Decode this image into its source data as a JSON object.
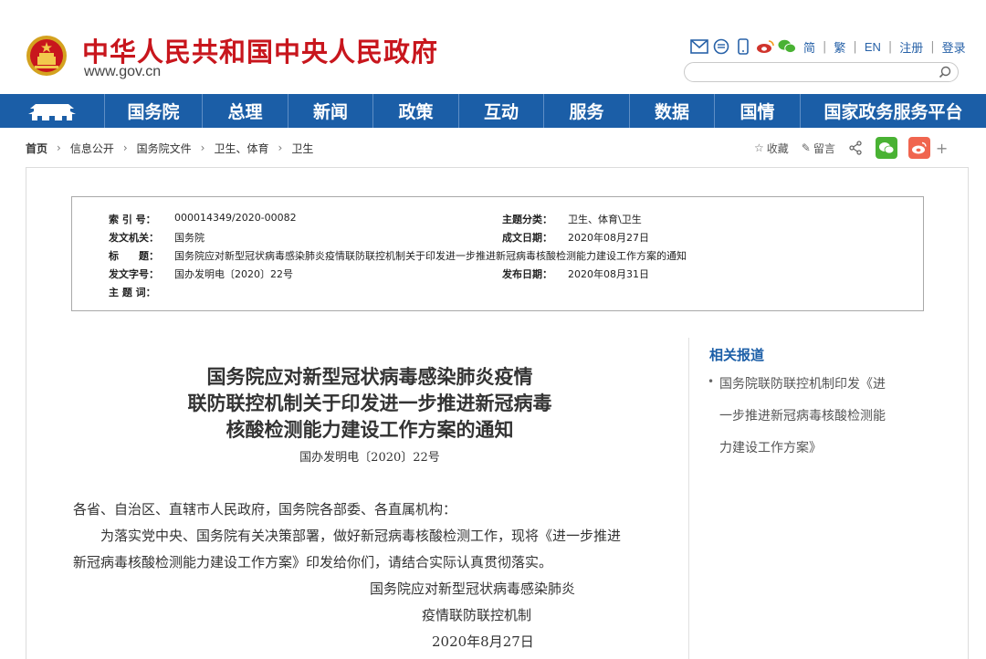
{
  "header": {
    "site_title": "中华人民共和国中央人民政府",
    "site_url": "www.gov.cn",
    "top_links": [
      "简",
      "繁",
      "EN",
      "注册",
      "登录"
    ],
    "search_placeholder": ""
  },
  "nav": {
    "items": [
      "国务院",
      "总理",
      "新闻",
      "政策",
      "互动",
      "服务",
      "数据",
      "国情",
      "国家政务服务平台"
    ]
  },
  "breadcrumb": [
    "首页",
    "信息公开",
    "国务院文件",
    "卫生、体育",
    "卫生"
  ],
  "share": {
    "collect": "收藏",
    "comment": "留言",
    "plus": "+"
  },
  "meta": {
    "index_label": "索 引 号：",
    "index_value": "000014349/2020-00082",
    "topic_label": "主题分类：",
    "topic_value": "卫生、体育\\卫生",
    "issuer_label": "发文机关：",
    "issuer_value": "国务院",
    "written_label": "成文日期：",
    "written_value": "2020年08月27日",
    "title_label": "标　　题：",
    "title_value": "国务院应对新型冠状病毒感染肺炎疫情联防联控机制关于印发进一步推进新冠病毒核酸检测能力建设工作方案的通知",
    "docno_label": "发文字号：",
    "docno_value": "国办发明电〔2020〕22号",
    "published_label": "发布日期：",
    "published_value": "2020年08月31日",
    "keywords_label": "主 题 词："
  },
  "article": {
    "title_lines": [
      "国务院应对新型冠状病毒感染肺炎疫情",
      "联防联控机制关于印发进一步推进新冠病毒",
      "核酸检测能力建设工作方案的通知"
    ],
    "doc_number": "国办发明电〔2020〕22号",
    "body_lines": [
      "各省、自治区、直辖市人民政府，国务院各部委、各直属机构：",
      "　　为落实党中央、国务院有关决策部署，做好新冠病毒核酸检测工作，现将《进一步推进",
      "新冠病毒核酸检测能力建设工作方案》印发给你们，请结合实际认真贯彻落实。"
    ],
    "signature_lines": [
      "国务院应对新型冠状病毒感染肺炎",
      "疫情联防联控机制",
      "2020年8月27日"
    ]
  },
  "related": {
    "title": "相关报道",
    "item_lines": [
      "国务院联防联控机制印发《进",
      "一步推进新冠病毒核酸检测能",
      "力建设工作方案》"
    ]
  },
  "colors": {
    "brand_red": "#c8161d",
    "nav_blue": "#1b5ea7",
    "link_blue": "#2862a8",
    "wechat_green": "#49b233",
    "weibo_red": "#f0654f"
  }
}
